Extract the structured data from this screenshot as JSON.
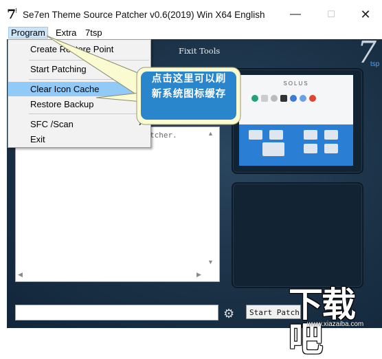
{
  "window": {
    "logo": "7",
    "title": "Se7en Theme Source Patcher v0.6(2019) Win X64 English",
    "minimize": "—",
    "maximize": "☐",
    "close": "✕"
  },
  "menubar": {
    "items": [
      "Program",
      "Extra",
      "7tsp"
    ]
  },
  "program_menu": {
    "items": [
      {
        "label": "Create Restore Point"
      },
      {
        "label": "Start Patching"
      },
      {
        "label": "Clear Icon Cache",
        "highlighted": true
      },
      {
        "label": "Restore Backup"
      },
      {
        "label": "SFC /Scan",
        "submenu_arrow": "›"
      },
      {
        "label": "Exit"
      }
    ]
  },
  "main": {
    "section_title": "Fixit Tools",
    "brand": "7",
    "brand_sub": "tsp",
    "log_text": "tcher.",
    "preview_brand": "SOLUS",
    "start_button": "Start Patch"
  },
  "callout": {
    "line1": "点击这里可以刷",
    "line2": "新系统图标缓存",
    "fill": "#fbfbd2",
    "box": "#2a86cc"
  },
  "watermark": {
    "logo": "下载吧",
    "url": "www.xiazaiba.com"
  },
  "colors": {
    "panel": "#1b3247",
    "highlight": "#91c9f7",
    "menu_active": "#cce4f7"
  }
}
